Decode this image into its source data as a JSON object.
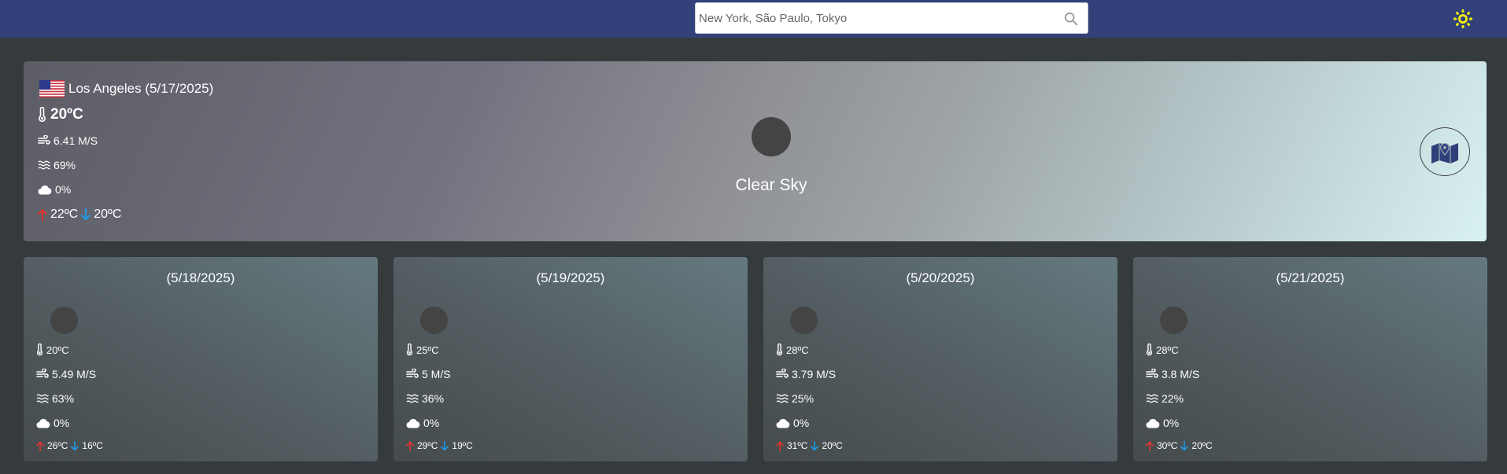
{
  "search": {
    "placeholder": "New York, São Paulo, Tokyo"
  },
  "current": {
    "city": "Los Angeles (5/17/2025)",
    "temperature": "20ºC",
    "wind": "6.41 M/S",
    "humidity": "69%",
    "clouds": "0%",
    "max": "22ºC",
    "min": "20ºC",
    "description": "Clear Sky"
  },
  "forecast": [
    {
      "date": "(5/18/2025)",
      "temp": "20ºC",
      "wind": "5.49 M/S",
      "humidity": "63%",
      "clouds": "0%",
      "max": "26ºC",
      "min": "16ºC"
    },
    {
      "date": "(5/19/2025)",
      "temp": "25ºC",
      "wind": "5 M/S",
      "humidity": "36%",
      "clouds": "0%",
      "max": "29ºC",
      "min": "19ºC"
    },
    {
      "date": "(5/20/2025)",
      "temp": "28ºC",
      "wind": "3.79 M/S",
      "humidity": "25%",
      "clouds": "0%",
      "max": "31ºC",
      "min": "20ºC"
    },
    {
      "date": "(5/21/2025)",
      "temp": "28ºC",
      "wind": "3.8 M/S",
      "humidity": "22%",
      "clouds": "0%",
      "max": "30ºC",
      "min": "20ºC"
    }
  ],
  "icons": {
    "search": "search-icon",
    "theme": "sun-icon",
    "flag": "us-flag-icon",
    "temperature": "thermometer-icon",
    "wind": "wind-icon",
    "humidity": "humidity-icon",
    "clouds": "cloud-icon",
    "max": "arrow-up-icon",
    "min": "arrow-down-icon",
    "map": "map-icon"
  },
  "colors": {
    "navbar": "#33417a",
    "background": "#353a3d",
    "accent_sun": "#f2f20a",
    "arrow_up": "#e3342f",
    "arrow_down": "#1e9be8"
  }
}
